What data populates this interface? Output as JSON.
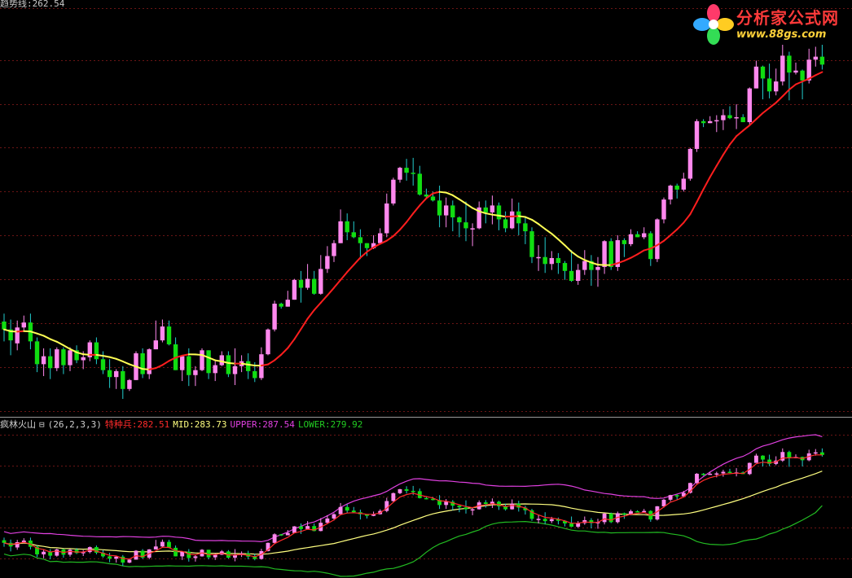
{
  "top_label": "趋势线:262.54",
  "indicator": {
    "name": "疯林火山",
    "params": "(26,2,3,3)",
    "special_label": "特种兵:282.51",
    "mid_label": "MID:283.73",
    "upper_label": "UPPER:287.54",
    "lower_label": "LOWER:279.92"
  },
  "logo": {
    "text": "分析家公式网",
    "url": "www.88gs.com"
  },
  "colors": {
    "up_candle": "#ff88ee",
    "down_candle": "#11dd11",
    "wick_down": "#22cccc",
    "trend_down": "#ffff55",
    "trend_up": "#ff1e1e",
    "upper": "#e040e0",
    "mid": "#ffff80",
    "lower": "#22bb22",
    "special": "#ff2a2a",
    "grid": "#6b1515"
  },
  "chart_data": {
    "type": "candlestick",
    "panels": [
      {
        "name": "price",
        "series": [
          {
            "name": "趋势线",
            "kind": "line"
          }
        ]
      },
      {
        "name": "疯林火山",
        "series": [
          {
            "name": "特种兵",
            "value": 282.51
          },
          {
            "name": "MID",
            "value": 283.73
          },
          {
            "name": "UPPER",
            "value": 287.54
          },
          {
            "name": "LOWER",
            "value": 279.92
          }
        ]
      }
    ],
    "candles": [
      [
        50.4,
        49.6,
        51.2,
        48.4
      ],
      [
        49.6,
        48.5,
        50.6,
        47
      ],
      [
        48.2,
        49.8,
        50.5,
        47.5
      ],
      [
        49.8,
        50.3,
        51,
        49.5
      ],
      [
        50.3,
        48.4,
        51.2,
        47.6
      ],
      [
        48.4,
        46.1,
        48.8,
        45.3
      ],
      [
        46.1,
        46.9,
        47.7,
        44.9
      ],
      [
        46.9,
        45.7,
        47.7,
        44.6
      ],
      [
        45.7,
        47.6,
        47.8,
        45.4
      ],
      [
        47.6,
        46,
        47.8,
        45.1
      ],
      [
        46,
        47.5,
        47.8,
        45.4
      ],
      [
        47.5,
        46.5,
        48,
        46.2
      ],
      [
        46.5,
        46.8,
        47.4,
        45.6
      ],
      [
        46.8,
        48.3,
        48.5,
        46.4
      ],
      [
        48.3,
        46.6,
        48.8,
        46.1
      ],
      [
        46.6,
        45.5,
        47.4,
        45.1
      ],
      [
        45.5,
        44.8,
        46.6,
        43.7
      ],
      [
        44.8,
        45.4,
        45.6,
        43.6
      ],
      [
        45.4,
        43.6,
        45.9,
        42.6
      ],
      [
        43.6,
        44.5,
        44.6,
        43.4
      ],
      [
        44.5,
        47.2,
        47.4,
        44.5
      ],
      [
        47.2,
        45.1,
        47.7,
        44.7
      ],
      [
        45.1,
        47.6,
        47.7,
        44.6
      ],
      [
        47.6,
        48.5,
        50.5,
        47.6
      ],
      [
        48.5,
        49.9,
        50.6,
        48.3
      ],
      [
        49.9,
        48.1,
        50.5,
        48
      ],
      [
        48.1,
        45.5,
        48.8,
        45.5
      ],
      [
        45.5,
        46.9,
        46.9,
        44.4
      ],
      [
        46.9,
        45,
        47.7,
        43.9
      ],
      [
        45,
        45.5,
        45.9,
        43.9
      ],
      [
        45.5,
        47.5,
        47.7,
        45.4
      ],
      [
        47.5,
        45.2,
        47.5,
        44.6
      ],
      [
        45.2,
        46,
        46.4,
        44.4
      ],
      [
        46,
        47,
        47.4,
        45.9
      ],
      [
        47,
        45.1,
        47.4,
        44.8
      ],
      [
        45.1,
        45.9,
        47.7,
        44
      ],
      [
        45.9,
        46.4,
        47,
        45.3
      ],
      [
        46.4,
        45.4,
        47.2,
        44.6
      ],
      [
        45.4,
        44.7,
        46.3,
        44.3
      ],
      [
        44.7,
        47.1,
        47.8,
        44.5
      ],
      [
        47.1,
        49.6,
        49.7,
        47
      ],
      [
        49.6,
        52.2,
        52.5,
        49.4
      ],
      [
        52.2,
        51.9,
        52.3,
        51.7
      ],
      [
        51.9,
        52.6,
        53.5,
        51.9
      ],
      [
        52.6,
        54.6,
        54.7,
        52.6
      ],
      [
        54.6,
        53.8,
        55.5,
        52.3
      ],
      [
        53.8,
        54.7,
        56.2,
        53.6
      ],
      [
        54.7,
        53.2,
        55.5,
        53.1
      ],
      [
        53.2,
        55.7,
        57.1,
        53.1
      ],
      [
        55.7,
        57,
        58,
        55.3
      ],
      [
        57,
        58.3,
        58.6,
        56.4
      ],
      [
        58.3,
        60.5,
        61.7,
        58.3
      ],
      [
        60.5,
        59.4,
        61.3,
        58.6
      ],
      [
        59.4,
        58.9,
        60.5,
        58.8
      ],
      [
        58.9,
        58.3,
        59.7,
        56.7
      ],
      [
        58.3,
        57.8,
        58.3,
        57
      ],
      [
        57.8,
        58.3,
        59.1,
        57.7
      ],
      [
        58.3,
        59.3,
        59.8,
        58.2
      ],
      [
        59.3,
        62.3,
        63.3,
        58.9
      ],
      [
        62.3,
        64.7,
        64.9,
        62.1
      ],
      [
        64.7,
        65.9,
        66,
        64.4
      ],
      [
        65.9,
        65.4,
        66.8,
        64.6
      ],
      [
        65.4,
        65.3,
        66.9,
        64.1
      ],
      [
        65.3,
        63.2,
        66.1,
        63.1
      ],
      [
        63.2,
        63,
        63.8,
        62.8
      ],
      [
        63,
        62.6,
        63.5,
        62.5
      ],
      [
        62.6,
        61.1,
        64.1,
        59.9
      ],
      [
        61.1,
        62.1,
        62.9,
        59.9
      ],
      [
        62.1,
        60.9,
        62.6,
        59.5
      ],
      [
        60.9,
        60.4,
        61,
        58.9
      ],
      [
        60.4,
        59.8,
        62.5,
        58.5
      ],
      [
        59.8,
        59.8,
        60.3,
        58
      ],
      [
        59.8,
        61.9,
        62.5,
        59.7
      ],
      [
        61.9,
        61.4,
        62.6,
        60.3
      ],
      [
        61.4,
        62.1,
        63.1,
        60.2
      ],
      [
        62.1,
        60.7,
        62.4,
        59.6
      ],
      [
        60.7,
        59.8,
        61.5,
        59.4
      ],
      [
        59.8,
        61.5,
        62.8,
        59.7
      ],
      [
        61.5,
        60.3,
        62.4,
        59.1
      ],
      [
        60.3,
        59.5,
        60.9,
        58.2
      ],
      [
        59.5,
        56.9,
        59.9,
        56.3
      ],
      [
        56.9,
        56.9,
        58.1,
        55.5
      ],
      [
        56.9,
        56.2,
        58.9,
        55.3
      ],
      [
        56.2,
        56.8,
        57.5,
        55.6
      ],
      [
        56.8,
        56.3,
        57.3,
        55.2
      ],
      [
        56.3,
        55.5,
        56.5,
        54.6
      ],
      [
        55.5,
        54.5,
        57.6,
        54.4
      ],
      [
        54.5,
        55.6,
        56.2,
        54.1
      ],
      [
        55.6,
        56.5,
        57.6,
        55.1
      ],
      [
        56.5,
        55.6,
        57.1,
        54
      ],
      [
        55.6,
        55.9,
        56.9,
        53.9
      ],
      [
        55.9,
        58.5,
        58.6,
        55.2
      ],
      [
        58.5,
        55.9,
        58.8,
        55.6
      ],
      [
        55.9,
        58.6,
        59.1,
        55.5
      ],
      [
        58.6,
        58.2,
        58.8,
        56.9
      ],
      [
        58.2,
        59.2,
        59.7,
        58
      ],
      [
        59.2,
        58.9,
        59.5,
        58.9
      ],
      [
        58.9,
        59.3,
        59.9,
        58.7
      ],
      [
        59.3,
        56.7,
        59.5,
        56
      ],
      [
        56.7,
        60.7,
        60.8,
        56.4
      ],
      [
        60.7,
        62.7,
        62.9,
        60.3
      ],
      [
        62.7,
        64.1,
        64.2,
        62.2
      ],
      [
        64.1,
        63.7,
        64.3,
        62.8
      ],
      [
        63.7,
        64.8,
        65.4,
        63.5
      ],
      [
        64.8,
        67.8,
        67.9,
        64.6
      ],
      [
        67.8,
        70.6,
        70.8,
        67.5
      ],
      [
        70.6,
        70.4,
        70.8,
        70
      ],
      [
        70.4,
        70.6,
        71.1,
        70.4
      ],
      [
        70.6,
        70.7,
        71.2,
        69.5
      ],
      [
        70.7,
        71.2,
        71.8,
        69.7
      ],
      [
        71.2,
        70.9,
        72.1,
        70.8
      ],
      [
        70.9,
        71,
        72.3,
        69.8
      ],
      [
        71,
        70.5,
        71.3,
        70.5
      ],
      [
        70.5,
        73.9,
        74,
        70.2
      ],
      [
        73.9,
        76.1,
        76.7,
        73.9
      ],
      [
        76.1,
        74.9,
        76.2,
        72.8
      ],
      [
        74.9,
        73.6,
        76.4,
        72.9
      ],
      [
        73.6,
        74.6,
        75.9,
        73.2
      ],
      [
        74.6,
        77.2,
        78.3,
        74.2
      ],
      [
        77.2,
        75.5,
        77.6,
        72.7
      ],
      [
        75.5,
        75.7,
        76.5,
        75.3
      ],
      [
        75.7,
        74.7,
        75.8,
        72.8
      ],
      [
        74.7,
        76.8,
        77.9,
        74.4
      ],
      [
        76.8,
        77.1,
        78.1,
        76.1
      ],
      [
        77.1,
        76.3,
        78.3,
        75.8
      ]
    ]
  }
}
